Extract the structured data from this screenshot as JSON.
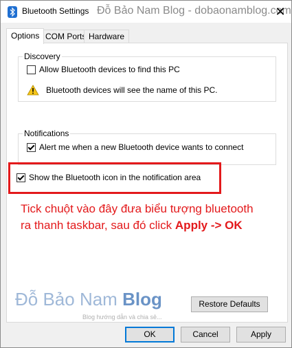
{
  "window": {
    "title": "Bluetooth Settings",
    "title_watermark": "Đỗ Bảo Nam Blog - dobaonamblog.com",
    "close_symbol": "✕"
  },
  "tabs": [
    {
      "label": "Options",
      "active": true
    },
    {
      "label": "COM Ports",
      "active": false
    },
    {
      "label": "Hardware",
      "active": false
    }
  ],
  "discovery": {
    "group_label": "Discovery",
    "allow_label": "Allow Bluetooth devices to find this PC",
    "allow_checked": false,
    "warning_text": "Bluetooth devices will see the name of this PC."
  },
  "notifications": {
    "group_label": "Notifications",
    "alert_label": "Alert me when a new Bluetooth device wants to connect",
    "alert_checked": true
  },
  "show_icon": {
    "label": "Show the Bluetooth icon in the notification area",
    "checked": true
  },
  "annotation": {
    "line1": "Tick chuột vào đây đưa biểu tượng bluetooth",
    "line2_prefix": "ra thanh taskbar, sau đó click ",
    "line2_bold": "Apply -> OK"
  },
  "watermark": {
    "name": "Đỗ Bảo Nam",
    "blog": "Blog",
    "tagline": "Blog hướng dẫn và chia sẻ..."
  },
  "buttons": {
    "restore_defaults": "Restore Defaults",
    "ok": "OK",
    "cancel": "Cancel",
    "apply": "Apply"
  },
  "colors": {
    "annotation_red": "#e3191b",
    "accent_blue": "#0078d7"
  }
}
